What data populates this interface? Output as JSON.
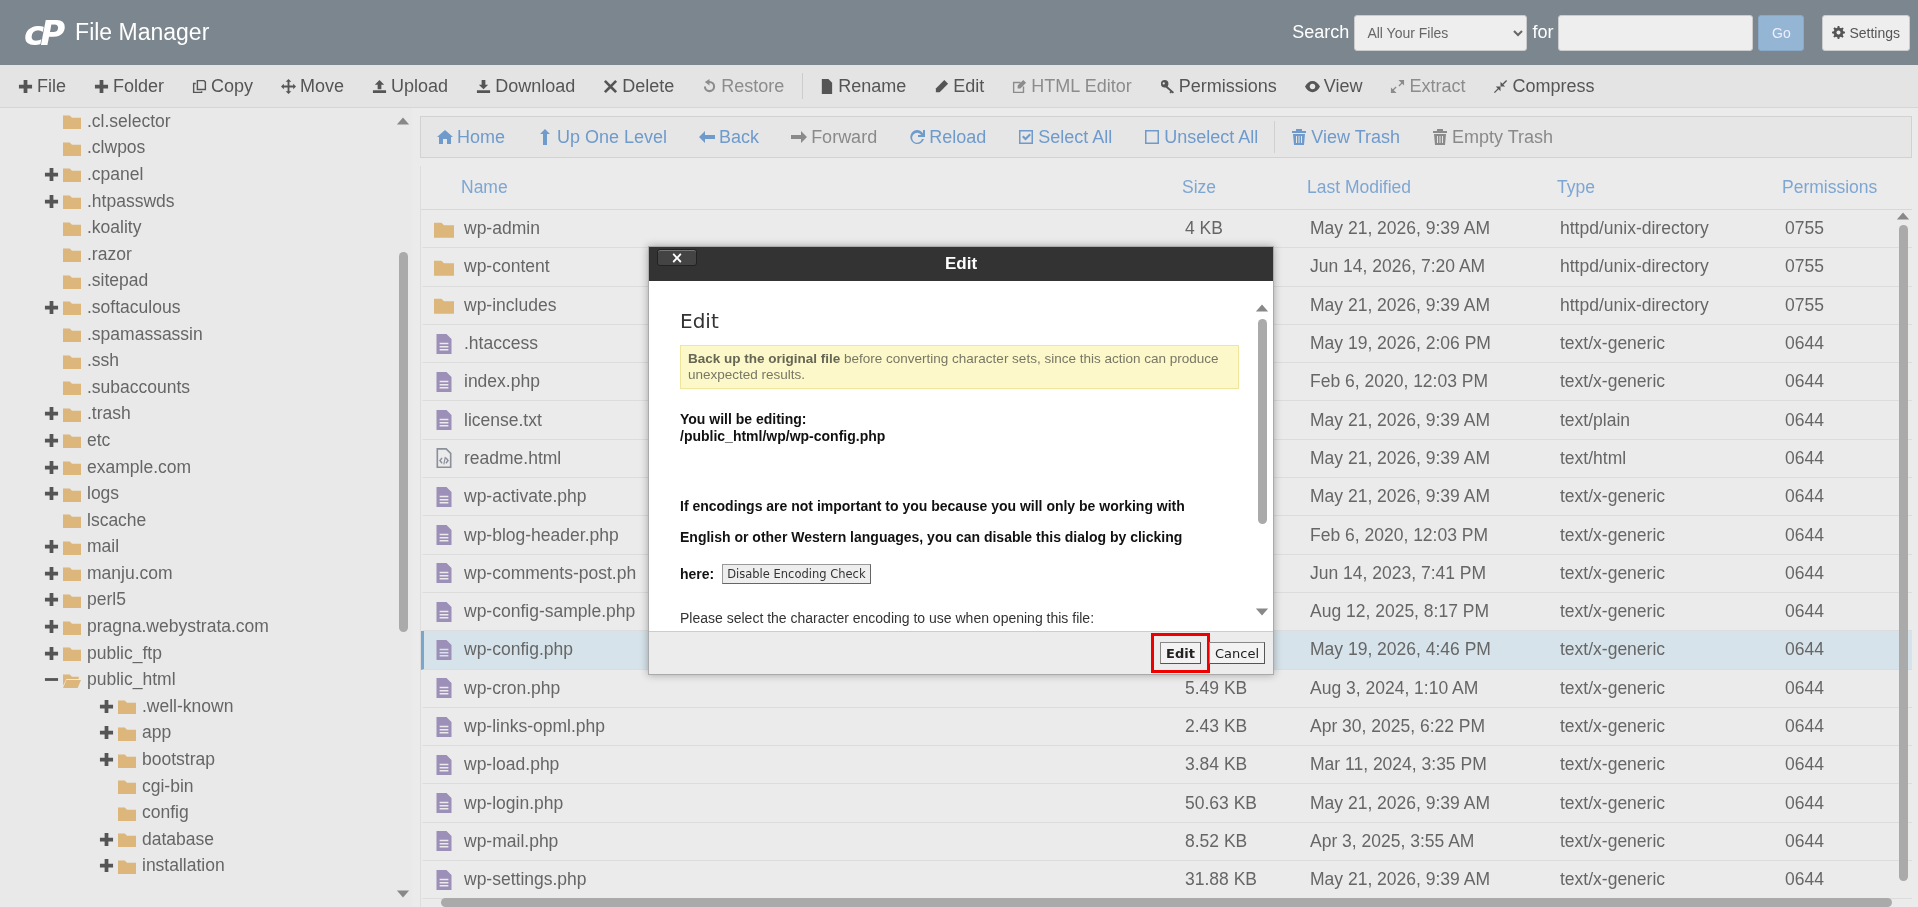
{
  "header": {
    "logo": "cP",
    "title": "File Manager",
    "search_label": "Search",
    "scope": "All Your Files",
    "for_label": "for",
    "go_button": "Go",
    "settings_button": "Settings"
  },
  "toolbar": [
    {
      "label": "File",
      "disabled": false
    },
    {
      "label": "Folder",
      "disabled": false
    },
    {
      "label": "Copy",
      "disabled": false
    },
    {
      "label": "Move",
      "disabled": false
    },
    {
      "label": "Upload",
      "disabled": false
    },
    {
      "label": "Download",
      "disabled": false
    },
    {
      "label": "Delete",
      "disabled": false
    },
    {
      "label": "Restore",
      "disabled": true
    },
    {
      "label": "Rename",
      "disabled": false
    },
    {
      "label": "Edit",
      "disabled": false
    },
    {
      "label": "HTML Editor",
      "disabled": true
    },
    {
      "label": "Permissions",
      "disabled": false
    },
    {
      "label": "View",
      "disabled": false
    },
    {
      "label": "Extract",
      "disabled": true
    },
    {
      "label": "Compress",
      "disabled": false
    }
  ],
  "tree": [
    {
      "label": ".cl.selector",
      "kind": "leaf",
      "expanded": false
    },
    {
      "label": ".clwpos",
      "kind": "leaf",
      "expanded": false
    },
    {
      "label": ".cpanel",
      "kind": "branch",
      "expanded": false
    },
    {
      "label": ".htpasswds",
      "kind": "branch",
      "expanded": false
    },
    {
      "label": ".koality",
      "kind": "leaf",
      "expanded": false
    },
    {
      "label": ".razor",
      "kind": "leaf",
      "expanded": false
    },
    {
      "label": ".sitepad",
      "kind": "leaf",
      "expanded": false
    },
    {
      "label": ".softaculous",
      "kind": "branch",
      "expanded": false
    },
    {
      "label": ".spamassassin",
      "kind": "leaf",
      "expanded": false
    },
    {
      "label": ".ssh",
      "kind": "leaf",
      "expanded": false
    },
    {
      "label": ".subaccounts",
      "kind": "leaf",
      "expanded": false
    },
    {
      "label": ".trash",
      "kind": "branch",
      "expanded": false
    },
    {
      "label": "etc",
      "kind": "branch",
      "expanded": false
    },
    {
      "label": "example.com",
      "kind": "branch",
      "expanded": false
    },
    {
      "label": "logs",
      "kind": "branch",
      "expanded": false
    },
    {
      "label": "lscache",
      "kind": "leaf",
      "expanded": false
    },
    {
      "label": "mail",
      "kind": "branch",
      "expanded": false
    },
    {
      "label": "manju.com",
      "kind": "branch",
      "expanded": false
    },
    {
      "label": "perl5",
      "kind": "branch",
      "expanded": false
    },
    {
      "label": "pragna.webystrata.com",
      "kind": "branch",
      "expanded": false
    },
    {
      "label": "public_ftp",
      "kind": "branch",
      "expanded": false
    },
    {
      "label": "public_html",
      "kind": "branch",
      "expanded": true,
      "children": [
        {
          "label": ".well-known",
          "kind": "branch",
          "expanded": false
        },
        {
          "label": "app",
          "kind": "branch",
          "expanded": false
        },
        {
          "label": "bootstrap",
          "kind": "branch",
          "expanded": false
        },
        {
          "label": "cgi-bin",
          "kind": "leaf",
          "expanded": false
        },
        {
          "label": "config",
          "kind": "leaf",
          "expanded": false
        },
        {
          "label": "database",
          "kind": "branch",
          "expanded": false
        },
        {
          "label": "installation",
          "kind": "branch",
          "expanded": false
        }
      ]
    }
  ],
  "nav": [
    {
      "label": "Home",
      "disabled": false
    },
    {
      "label": "Up One Level",
      "disabled": false
    },
    {
      "label": "Back",
      "disabled": false
    },
    {
      "label": "Forward",
      "disabled": true
    },
    {
      "label": "Reload",
      "disabled": false
    },
    {
      "label": "Select All",
      "disabled": false
    },
    {
      "label": "Unselect All",
      "disabled": false
    },
    {
      "label": "View Trash",
      "disabled": false
    },
    {
      "label": "Empty Trash",
      "disabled": true
    }
  ],
  "table": {
    "columns": [
      "Name",
      "Size",
      "Last Modified",
      "Type",
      "Permissions"
    ],
    "rows": [
      {
        "kind": "folder",
        "name": "wp-admin",
        "size": "4 KB",
        "modified": "May 21, 2026, 9:39 AM",
        "type": "httpd/unix-directory",
        "permissions": "0755",
        "selected": false
      },
      {
        "kind": "folder",
        "name": "wp-content",
        "modified": "Jun 14, 2026, 7:20 AM",
        "type": "httpd/unix-directory",
        "permissions": "0755",
        "selected": false
      },
      {
        "kind": "folder",
        "name": "wp-includes",
        "modified": "May 21, 2026, 9:39 AM",
        "type": "httpd/unix-directory",
        "permissions": "0755",
        "selected": false
      },
      {
        "kind": "file",
        "name": ".htaccess",
        "modified": "May 19, 2026, 2:06 PM",
        "type": "text/x-generic",
        "permissions": "0644",
        "selected": false
      },
      {
        "kind": "file",
        "name": "index.php",
        "modified": "Feb 6, 2020, 12:03 PM",
        "type": "text/x-generic",
        "permissions": "0644",
        "selected": false
      },
      {
        "kind": "file",
        "name": "license.txt",
        "modified": "May 21, 2026, 9:39 AM",
        "type": "text/plain",
        "permissions": "0644",
        "selected": false
      },
      {
        "kind": "html",
        "name": "readme.html",
        "modified": "May 21, 2026, 9:39 AM",
        "type": "text/html",
        "permissions": "0644",
        "selected": false
      },
      {
        "kind": "file",
        "name": "wp-activate.php",
        "modified": "May 21, 2026, 9:39 AM",
        "type": "text/x-generic",
        "permissions": "0644",
        "selected": false
      },
      {
        "kind": "file",
        "name": "wp-blog-header.php",
        "modified": "Feb 6, 2020, 12:03 PM",
        "type": "text/x-generic",
        "permissions": "0644",
        "selected": false
      },
      {
        "kind": "file",
        "name": "wp-comments-post.ph",
        "modified": "Jun 14, 2023, 7:41 PM",
        "type": "text/x-generic",
        "permissions": "0644",
        "selected": false
      },
      {
        "kind": "file",
        "name": "wp-config-sample.php",
        "modified": "Aug 12, 2025, 8:17 PM",
        "type": "text/x-generic",
        "permissions": "0644",
        "selected": false
      },
      {
        "kind": "file",
        "name": "wp-config.php",
        "modified": "May 19, 2026, 4:46 PM",
        "type": "text/x-generic",
        "permissions": "0644",
        "selected": true
      },
      {
        "kind": "file",
        "name": "wp-cron.php",
        "size": "5.49 KB",
        "modified": "Aug 3, 2024, 1:10 AM",
        "type": "text/x-generic",
        "permissions": "0644",
        "selected": false
      },
      {
        "kind": "file",
        "name": "wp-links-opml.php",
        "size": "2.43 KB",
        "modified": "Apr 30, 2025, 6:22 PM",
        "type": "text/x-generic",
        "permissions": "0644",
        "selected": false
      },
      {
        "kind": "file",
        "name": "wp-load.php",
        "size": "3.84 KB",
        "modified": "Mar 11, 2024, 3:35 PM",
        "type": "text/x-generic",
        "permissions": "0644",
        "selected": false
      },
      {
        "kind": "file",
        "name": "wp-login.php",
        "size": "50.63 KB",
        "modified": "May 21, 2026, 9:39 AM",
        "type": "text/x-generic",
        "permissions": "0644",
        "selected": false
      },
      {
        "kind": "file",
        "name": "wp-mail.php",
        "size": "8.52 KB",
        "modified": "Apr 3, 2025, 3:55 AM",
        "type": "text/x-generic",
        "permissions": "0644",
        "selected": false
      },
      {
        "kind": "file",
        "name": "wp-settings.php",
        "size": "31.88 KB",
        "modified": "May 21, 2026, 9:39 AM",
        "type": "text/x-generic",
        "permissions": "0644",
        "selected": false
      }
    ]
  },
  "dialog": {
    "title": "Edit",
    "close": "×",
    "heading": "Edit",
    "warning": "**Back up the original file** before converting character sets, since this action can produce unexpected results.",
    "editing_label": "You will be editing:",
    "path": "/public_html/wp/wp-config.php",
    "note": "If encodings are not important to you because you will only be working with English or other Western languages, you can disable this dialog by clicking",
    "here_label": "here:",
    "disable_button": "Disable Encoding Check",
    "prompt": "Please select the character encoding to use when opening this file:",
    "buttons": [
      {
        "label": "Edit",
        "highlighted": true
      },
      {
        "label": "Cancel",
        "highlighted": false
      }
    ]
  }
}
